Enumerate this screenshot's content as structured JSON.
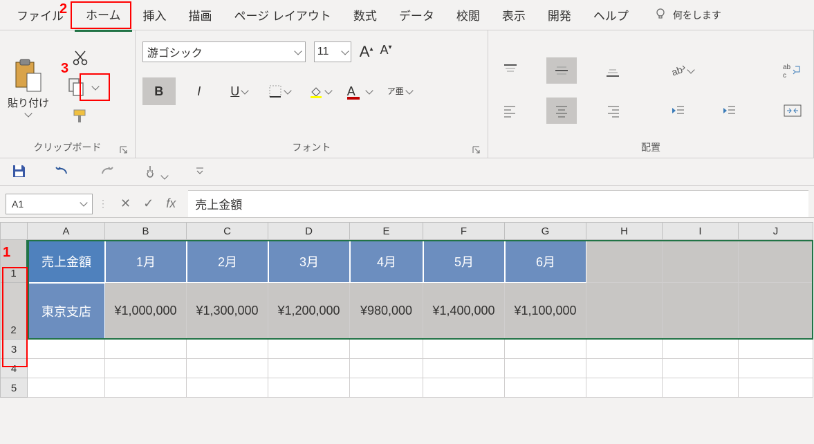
{
  "tabs": {
    "file": "ファイル",
    "home": "ホーム",
    "insert": "挿入",
    "draw": "描画",
    "pagelayout": "ページ レイアウト",
    "formulas": "数式",
    "data": "データ",
    "review": "校閲",
    "view": "表示",
    "developer": "開発",
    "help": "ヘルプ",
    "tellme": "何をします"
  },
  "ribbon": {
    "clipboard_label": "クリップボード",
    "paste_label": "貼り付け",
    "font_label": "フォント",
    "font_name": "游ゴシック",
    "font_size": "11",
    "alignment_label": "配置",
    "furigana": "ア亜"
  },
  "formula": {
    "name_box": "A1",
    "fx": "fx",
    "value": "売上金額"
  },
  "annotations": {
    "a1": "1",
    "a2": "2",
    "a3": "3"
  },
  "grid": {
    "cols": [
      "A",
      "B",
      "C",
      "D",
      "E",
      "F",
      "G",
      "H",
      "I",
      "J"
    ],
    "rows": [
      "1",
      "2",
      "3",
      "4",
      "5"
    ],
    "r1": {
      "A": "売上金額",
      "B": "1月",
      "C": "2月",
      "D": "3月",
      "E": "4月",
      "F": "5月",
      "G": "6月"
    },
    "r2": {
      "A": "東京支店",
      "B": "¥1,000,000",
      "C": "¥1,300,000",
      "D": "¥1,200,000",
      "E": "¥980,000",
      "F": "¥1,400,000",
      "G": "¥1,100,000"
    }
  },
  "chart_data": {
    "type": "table",
    "title": "売上金額",
    "categories": [
      "1月",
      "2月",
      "3月",
      "4月",
      "5月",
      "6月"
    ],
    "series": [
      {
        "name": "東京支店",
        "values": [
          1000000,
          1300000,
          1200000,
          980000,
          1400000,
          1100000
        ]
      }
    ],
    "currency": "JPY"
  }
}
